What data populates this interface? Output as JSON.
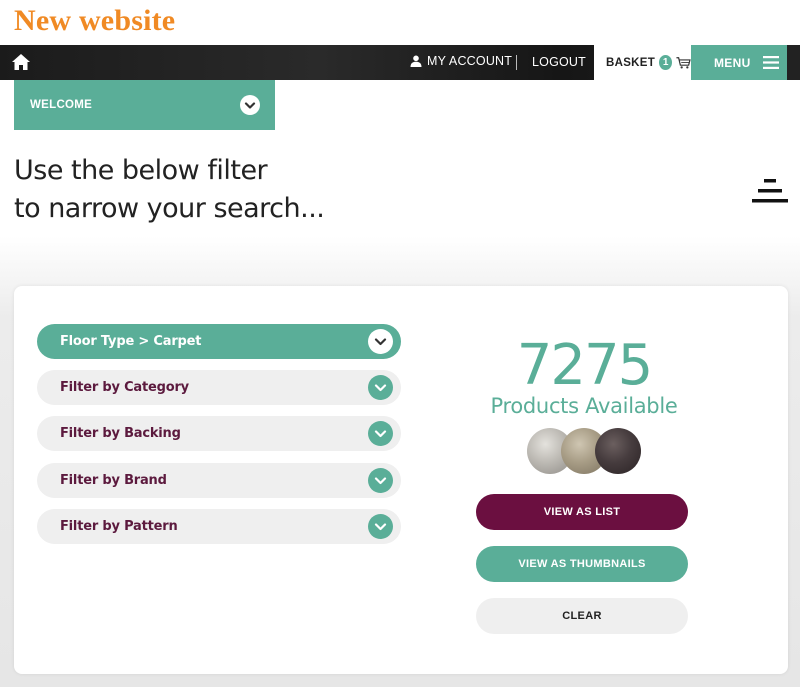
{
  "site": {
    "title": "New website"
  },
  "topbar": {
    "home_icon": "home-icon",
    "my_account": "MY ACCOUNT",
    "logout": "LOGOUT",
    "basket_label": "BASKET",
    "basket_count": "1",
    "menu_label": "MENU"
  },
  "welcome": {
    "label": "WELCOME"
  },
  "heading": {
    "line1": "Use the below filter",
    "line2": "to narrow your search..."
  },
  "filters": [
    {
      "label": "Floor Type > Carpet",
      "active": true
    },
    {
      "label": "Filter by Category",
      "active": false
    },
    {
      "label": "Filter by Backing",
      "active": false
    },
    {
      "label": "Filter by Brand",
      "active": false
    },
    {
      "label": "Filter by Pattern",
      "active": false
    }
  ],
  "results": {
    "count": "7275",
    "label": "Products Available"
  },
  "buttons": {
    "view_list": "VIEW AS LIST",
    "view_thumbs": "VIEW AS THUMBNAILS",
    "clear": "CLEAR"
  },
  "colors": {
    "brand_orange": "#f08a24",
    "accent_teal": "#5aae98",
    "primary_plum": "#6b0f40"
  }
}
